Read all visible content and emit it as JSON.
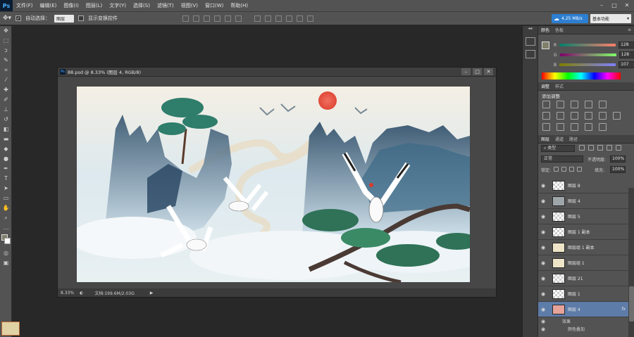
{
  "app": {
    "logo": "Ps"
  },
  "menu": [
    "文件(F)",
    "编辑(E)",
    "图像(I)",
    "图层(L)",
    "文字(Y)",
    "选择(S)",
    "滤镜(T)",
    "视图(V)",
    "窗口(W)",
    "帮助(H)"
  ],
  "options": {
    "auto_select_label": "自动选择：",
    "auto_select_value": "图层",
    "show_transform_label": "显示变换控件"
  },
  "network_speed": "4.25 MB/s",
  "workspace": "基本功能",
  "document": {
    "title": "88.psd @ 8.33% (图层 4, RGB/8)",
    "zoom": "8.33%",
    "doc_size": "文档:199.6M/2.03G"
  },
  "color_panel": {
    "tabs": [
      "颜色",
      "色板"
    ],
    "r_label": "R",
    "r_value": "128",
    "g_label": "G",
    "g_value": "128",
    "b_label": "B",
    "b_value": "107"
  },
  "adjust_panel": {
    "tabs": [
      "调整",
      "样式"
    ],
    "heading": "添加调整"
  },
  "layers_panel": {
    "tabs": [
      "图层",
      "通道",
      "路径"
    ],
    "kind_filter": "类型",
    "blend_mode": "正常",
    "opacity_label": "不透明度:",
    "opacity_value": "100%",
    "lock_label": "锁定:",
    "fill_label": "填充:",
    "fill_value": "100%",
    "layers": [
      "图层 8",
      "图层 4",
      "图层 5",
      "图层 1 副本",
      "图层组 1 副本",
      "图层组 1",
      "图层 21",
      "图层 1",
      "图层 4"
    ],
    "fx_label": "fx",
    "effects_label": "效果",
    "effect_item": "颜色叠加"
  },
  "colors": {
    "accent": "#5e7ca8",
    "menubar": "#535353",
    "background": "#282828"
  }
}
